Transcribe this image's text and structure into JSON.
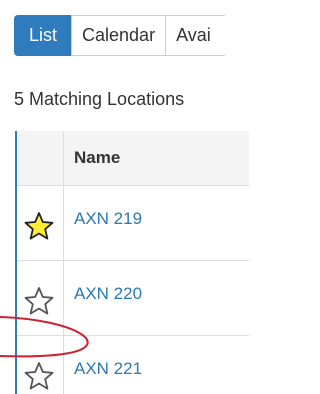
{
  "tabs": [
    {
      "label": "List",
      "active": true
    },
    {
      "label": "Calendar",
      "active": false
    },
    {
      "label": "Avai",
      "active": false
    }
  ],
  "result_count_text": "5 Matching Locations",
  "table": {
    "header": {
      "name": "Name"
    },
    "rows": [
      {
        "name": "AXN 219",
        "favorite": true
      },
      {
        "name": "AXN 220",
        "favorite": false
      },
      {
        "name": "AXN 221",
        "favorite": false
      }
    ]
  },
  "colors": {
    "accent": "#2e7bbd",
    "link": "#2a7ab0",
    "star_filled": "#ffee33",
    "annotation": "#cc2233"
  },
  "icons": {
    "favorite_filled": "star-filled-icon",
    "favorite_empty": "star-outline-icon"
  }
}
